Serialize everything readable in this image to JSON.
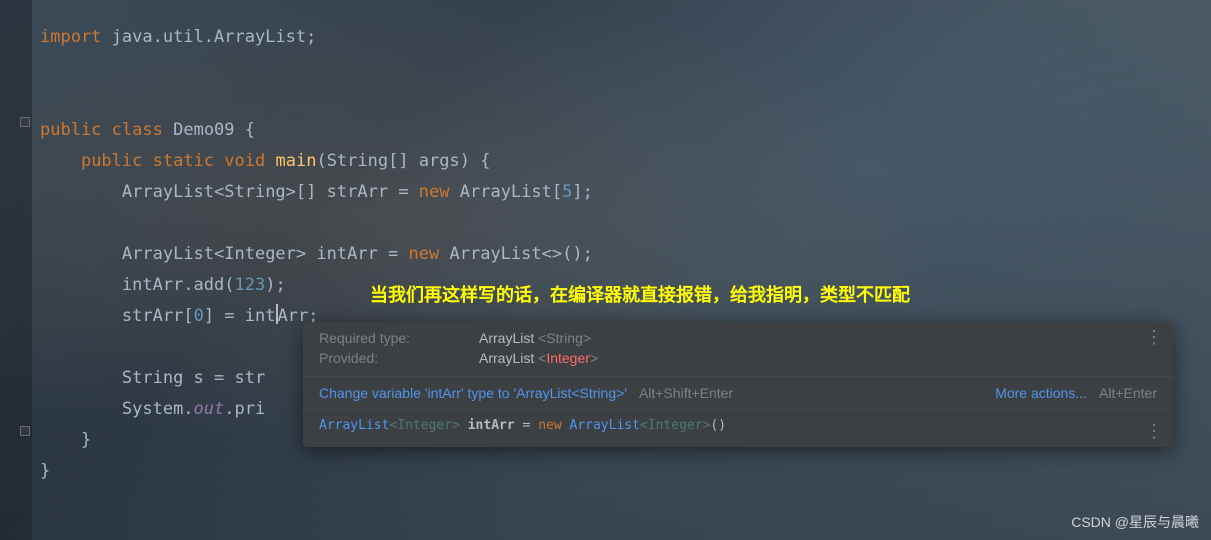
{
  "code": {
    "import_kw": "import",
    "import_pkg": " java.util.ArrayList;",
    "public_kw": "public",
    "class_kw": "class",
    "class_name": "Demo09",
    "static_kw": "static",
    "void_kw": "void",
    "main_name": "main",
    "main_params_open": "(String[] ",
    "main_params_arg": "args",
    "main_params_close": ") {",
    "arraylist": "ArrayList",
    "string_gen": "<String>",
    "integer_gen": "<Integer>",
    "brackets": "[]",
    "strarr": "strArr",
    "intarr": "intArr",
    "eq": " = ",
    "new_kw": "new",
    "arraylist_size": "[",
    "five": "5",
    "close_sz": "];",
    "diamond": "<>();",
    "add_call": ".add(",
    "num123": "123",
    "close_add": ");",
    "idx_open": "[",
    "zero": "0",
    "idx_close": "]",
    "semicolon": ";",
    "string_s": "String s = str",
    "sysout_pre": "System.",
    "out_field": "out",
    "pri": ".pri"
  },
  "annotation": "当我们再这样写的话，在编译器就直接报错，给我指明，类型不匹配",
  "popup": {
    "required_label": "Required type:",
    "required_value_base": "ArrayList ",
    "required_value_gen": "<String>",
    "provided_label": "Provided:",
    "provided_value_base": "ArrayList ",
    "provided_value_gen_open": "<",
    "provided_value_gen_err": "Integer",
    "provided_value_gen_close": ">",
    "fix_action": "Change variable 'intArr' type to 'ArrayList<String>'",
    "fix_shortcut": "Alt+Shift+Enter",
    "more_actions": "More actions...",
    "more_shortcut": "Alt+Enter",
    "code_hint_cls1": "ArrayList",
    "code_hint_gen1": "<Integer>",
    "code_hint_id": " intArr ",
    "code_hint_eq": "= ",
    "code_hint_new": "new ",
    "code_hint_cls2": "ArrayList",
    "code_hint_gen2": "<Integer>",
    "code_hint_tail": "()"
  },
  "watermark": "CSDN @星辰与晨曦"
}
